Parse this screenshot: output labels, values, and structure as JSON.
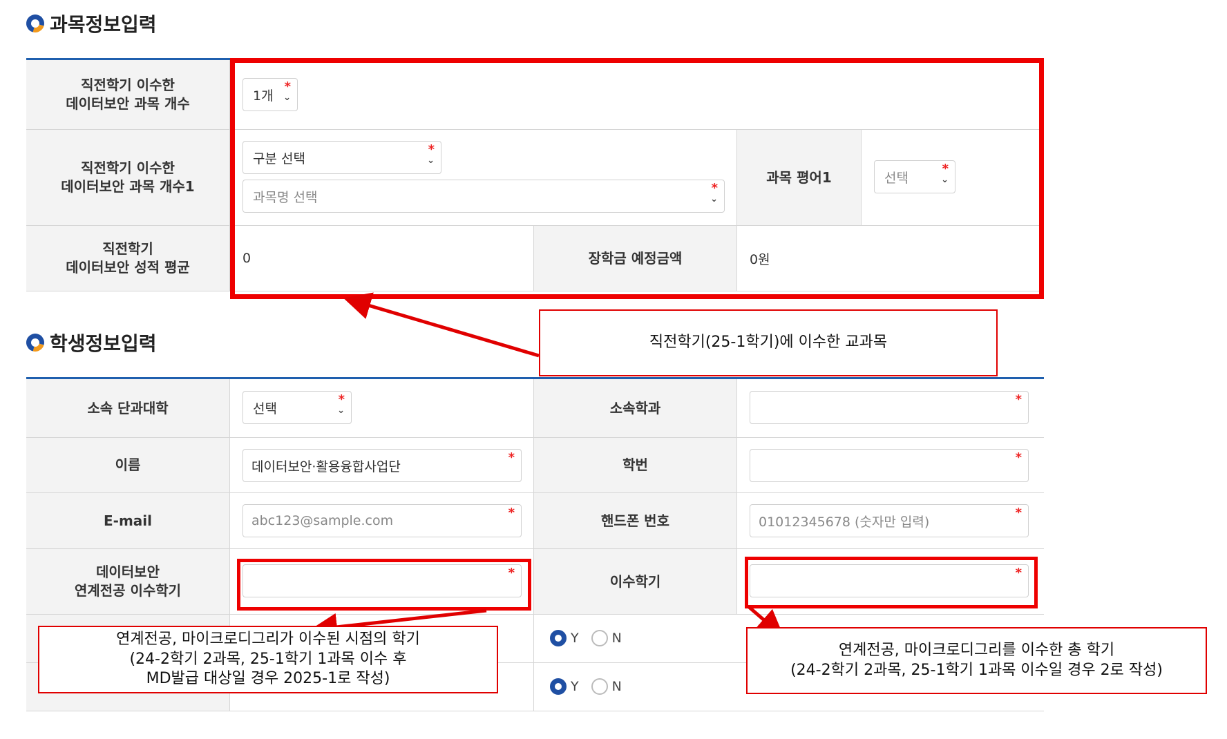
{
  "subject_section": {
    "title": "과목정보입력",
    "rows": [
      {
        "label": "직전학기 이수한\n데이터보안 과목 개수",
        "count_select": {
          "value": "1개",
          "required": "*"
        }
      },
      {
        "label": "직전학기 이수한\n데이터보안 과목 개수1",
        "category_select": {
          "value": "구분 선택",
          "required": "*"
        },
        "course_select": {
          "placeholder": "과목명 선택",
          "required": "*"
        },
        "grade_label": "과목 평어1",
        "grade_select": {
          "placeholder": "선택",
          "required": "*"
        }
      },
      {
        "label": "직전학기\n데이터보안 성적 평균",
        "average_value": "0",
        "scholarship_label": "장학금 예정금액",
        "scholarship_value": "0원"
      }
    ]
  },
  "student_section": {
    "title": "학생정보입력",
    "college": {
      "label": "소속 단과대학",
      "value": "선택",
      "required": "*"
    },
    "department": {
      "label": "소속학과",
      "value": "",
      "required": "*"
    },
    "name": {
      "label": "이름",
      "value": "데이터보안·활용융합사업단",
      "required": "*"
    },
    "student_id": {
      "label": "학번",
      "value": "",
      "required": "*"
    },
    "email": {
      "label": "E-mail",
      "placeholder": "abc123@sample.com",
      "required": "*"
    },
    "phone": {
      "label": "핸드폰 번호",
      "placeholder": "01012345678 (숫자만 입력)",
      "required": "*"
    },
    "linked_semester": {
      "label": "데이터보안\n연계전공 이수학기",
      "value": "",
      "required": "*"
    },
    "completed_semesters": {
      "label": "이수학기",
      "value": "",
      "required": "*"
    },
    "radio_rows": [
      {
        "yes": "Y",
        "no": "N",
        "selected": "Y"
      },
      {
        "yes": "Y",
        "no": "N",
        "selected": "Y"
      }
    ]
  },
  "annotations": {
    "callout_subject": "직전학기(25-1학기)에 이수한 교과목",
    "callout_linked": "연계전공, 마이크로디그리가 이수된 시점의 학기\n(24-2학기 2과목, 25-1학기 1과목 이수 후\nMD발급 대상일 경우 2025-1로 작성)",
    "callout_total": "연계전공, 마이크로디그리를 이수한 총 학기\n(24-2학기 2과목, 25-1학기 1과목 이수일 경우 2로 작성)",
    "highlight_color": "#ee0000"
  },
  "colors": {
    "accent_blue": "#1f5fae",
    "ring_orange": "#f29a1d",
    "required_red": "#e22222",
    "header_bg": "#f3f3f3"
  }
}
